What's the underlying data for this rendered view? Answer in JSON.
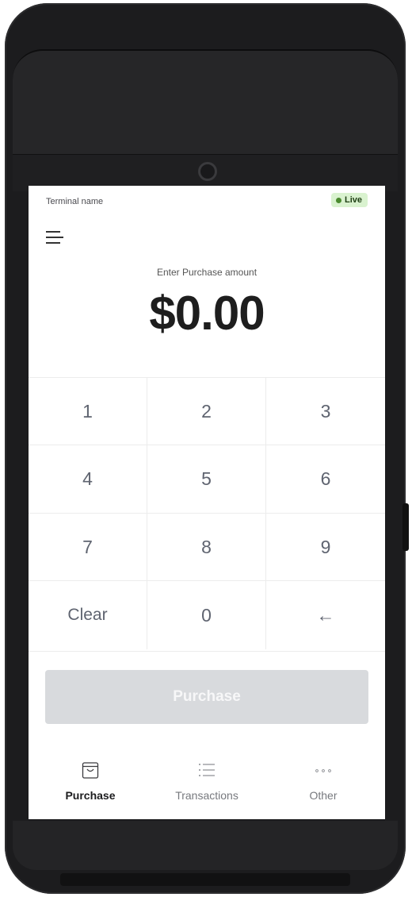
{
  "screen": {
    "terminal_name": "Terminal name",
    "status_badge": "Live",
    "prompt": "Enter Purchase amount",
    "amount": "$0.00"
  },
  "keypad": {
    "keys": [
      "1",
      "2",
      "3",
      "4",
      "5",
      "6",
      "7",
      "8",
      "9",
      "Clear",
      "0",
      "←"
    ]
  },
  "actions": {
    "purchase_label": "Purchase"
  },
  "nav": {
    "items": [
      {
        "label": "Purchase",
        "icon": "shopping-bag-icon",
        "active": true
      },
      {
        "label": "Transactions",
        "icon": "list-icon",
        "active": false
      },
      {
        "label": "Other",
        "icon": "more-dots-icon",
        "active": false
      }
    ]
  },
  "colors": {
    "live_badge_bg": "#d9f2cf",
    "live_dot": "#4a8a2e",
    "purchase_button_disabled": "#d8dadd",
    "device_body": "#1c1c1e"
  }
}
